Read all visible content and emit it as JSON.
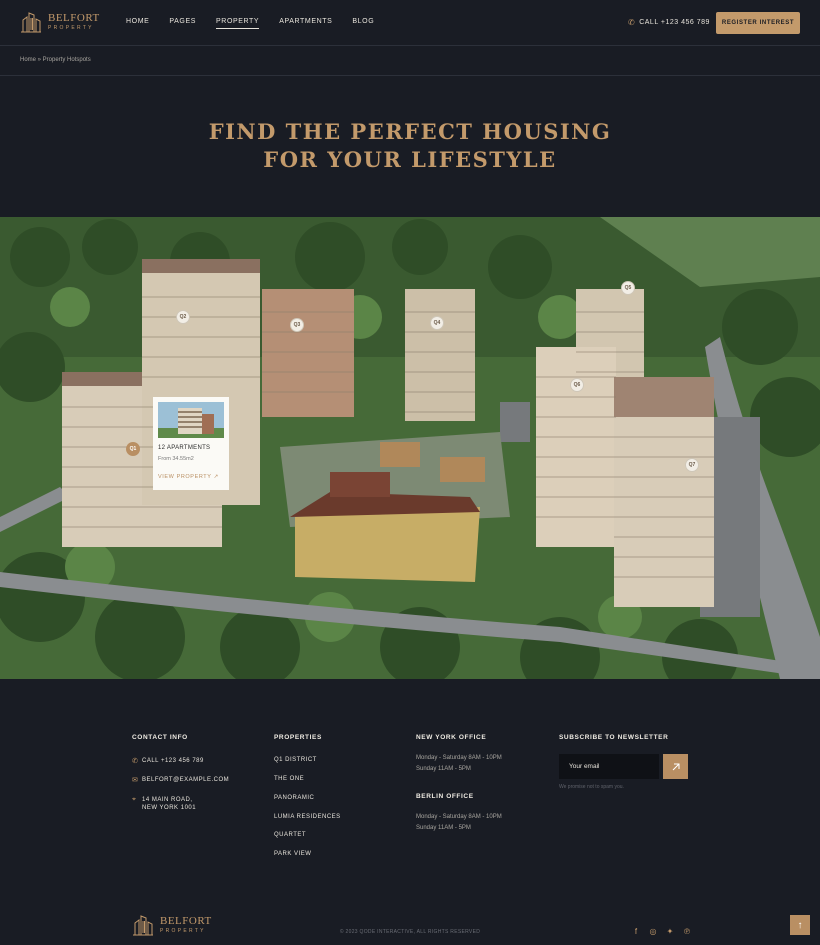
{
  "header": {
    "brand": "BELFORT",
    "brand_sub": "PROPERTY",
    "nav": [
      {
        "label": "HOME"
      },
      {
        "label": "PAGES"
      },
      {
        "label": "PROPERTY",
        "active": true
      },
      {
        "label": "APARTMENTS"
      },
      {
        "label": "BLOG"
      }
    ],
    "phone": "CALL +123 456 789",
    "cta": "REGISTER INTEREST"
  },
  "breadcrumb": "Home » Property Hotspots",
  "hero": {
    "line1": "FIND THE PERFECT HOUSING",
    "line2": "FOR YOUR LIFESTYLE"
  },
  "hotspots": [
    {
      "label": "Q1",
      "active": true
    },
    {
      "label": "Q2"
    },
    {
      "label": "Q3"
    },
    {
      "label": "Q4"
    },
    {
      "label": "Q5"
    },
    {
      "label": "Q6"
    },
    {
      "label": "Q7"
    }
  ],
  "popup": {
    "title": "12 APARTMENTS",
    "subtitle": "From 34.55m2",
    "link": "VIEW PROPERTY"
  },
  "footer": {
    "contact": {
      "heading": "CONTACT INFO",
      "phone": "CALL +123 456 789",
      "email": "BELFORT@EXAMPLE.COM",
      "address_line1": "14 MAIN ROAD,",
      "address_line2": "NEW YORK 1001"
    },
    "properties": {
      "heading": "PROPERTIES",
      "items": [
        "Q1 DISTRICT",
        "THE ONE",
        "PANORAMIC",
        "LUMIA RESIDENCES",
        "QUARTET",
        "PARK VIEW"
      ]
    },
    "ny_office": {
      "heading": "NEW YORK OFFICE",
      "line1": "Monday - Saturday 8AM - 10PM",
      "line2": "Sunday 11AM - 5PM"
    },
    "berlin_office": {
      "heading": "BERLIN OFFICE",
      "line1": "Monday - Saturday 8AM - 10PM",
      "line2": "Sunday 11AM - 5PM"
    },
    "newsletter": {
      "heading": "SUBSCRIBE TO NEWSLETTER",
      "placeholder": "Your email",
      "note": "We promise not to spam you."
    },
    "brand": "BELFORT",
    "brand_sub": "PROPERTY",
    "copyright": "© 2023 QODE INTERACTIVE, ALL RIGHTS RESERVED",
    "social": [
      "facebook-icon",
      "instagram-icon",
      "twitter-icon",
      "pinterest-icon"
    ]
  },
  "colors": {
    "background": "#191c24",
    "accent": "#c39a6b",
    "text": "#e8e4dc"
  }
}
